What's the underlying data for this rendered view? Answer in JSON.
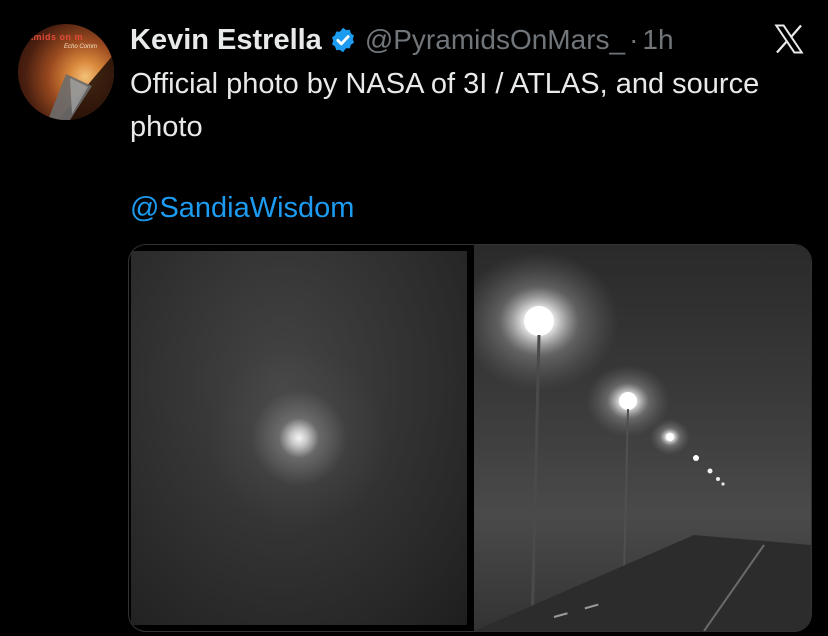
{
  "author": {
    "name": "Kevin Estrella",
    "handle": "@PyramidsOnMars_",
    "separator": "·",
    "time": "1h",
    "avatar_text_line1": "amids on m",
    "avatar_text_line2": "Echo Comm"
  },
  "tweet": {
    "text": "Official photo by NASA of 3I / ATLAS,  and source photo",
    "mention": "@SandiaWisdom"
  },
  "icons": {
    "verified": "verified-badge-icon",
    "platform": "x-logo-icon"
  },
  "colors": {
    "background": "#000000",
    "text": "#e7e9ea",
    "muted": "#71767b",
    "link": "#1d9bf0",
    "verified": "#1d9bf0"
  }
}
